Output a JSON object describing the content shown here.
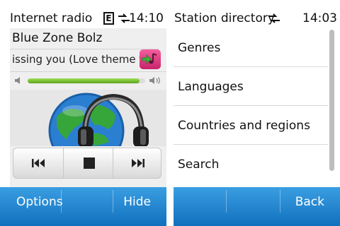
{
  "left_screen": {
    "status": {
      "title": "Internet radio",
      "network_badge": "E",
      "time": "14:10"
    },
    "player": {
      "station": "Blue Zone Bolz",
      "song": "issing you (Love theme from",
      "volume_level": 0.95
    },
    "controls": {
      "previous_icon": "skip-back-icon",
      "stop_icon": "stop-icon",
      "next_icon": "skip-forward-icon"
    },
    "softkeys": {
      "left": "Options",
      "right": "Hide"
    }
  },
  "right_screen": {
    "status": {
      "title": "Station directory",
      "time": "14:03"
    },
    "list": [
      {
        "label": "Genres"
      },
      {
        "label": "Languages"
      },
      {
        "label": "Countries and regions"
      },
      {
        "label": "Search"
      }
    ],
    "softkeys": {
      "right": "Back"
    }
  },
  "colors": {
    "softkey_bar": "#1f86d2",
    "volume_fill": "#7cc43a",
    "music_icon": "#e23d86"
  }
}
